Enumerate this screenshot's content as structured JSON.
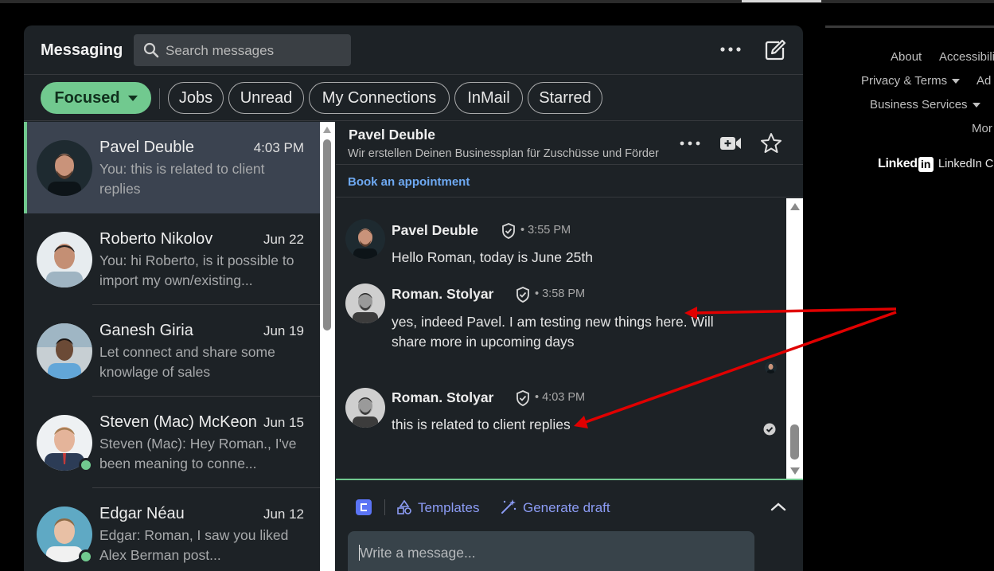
{
  "messaging": {
    "title": "Messaging",
    "search_placeholder": "Search messages",
    "more_icon": "more-horizontal-icon",
    "compose_icon": "compose-icon"
  },
  "filters": [
    {
      "label": "Focused",
      "active": true
    },
    {
      "label": "Jobs"
    },
    {
      "label": "Unread"
    },
    {
      "label": "My Connections"
    },
    {
      "label": "InMail"
    },
    {
      "label": "Starred"
    }
  ],
  "conversations": [
    {
      "name": "Pavel Deuble",
      "date": "4:03 PM",
      "preview": "You: this is related to client replies",
      "active": true,
      "online": false
    },
    {
      "name": "Roberto Nikolov",
      "date": "Jun 22",
      "preview": "You: hi Roberto, is it possible to import my own/existing...",
      "online": false
    },
    {
      "name": "Ganesh Giria",
      "date": "Jun 19",
      "preview": "Let connect and share some knowlage of sales",
      "online": false
    },
    {
      "name": "Steven (Mac) McKeon",
      "date": "Jun 15",
      "preview": "Steven (Mac): Hey Roman., I've been meaning to conne...",
      "online": true
    },
    {
      "name": "Edgar Néau",
      "date": "Jun 12",
      "preview": "Edgar: Roman, I saw you liked Alex Berman post...",
      "online": true
    }
  ],
  "thread": {
    "name": "Pavel Deuble",
    "subtitle": "Wir erstellen Deinen Businessplan für Zuschüsse und Förder",
    "book_link": "Book an appointment",
    "messages": [
      {
        "sender": "Pavel Deuble",
        "time": "• 3:55 PM",
        "text": "Hello Roman, today is June 25th"
      },
      {
        "sender": "Roman. Stolyar",
        "time": "• 3:58 PM",
        "text": "yes, indeed Pavel. I am testing new things here. Will share more in upcoming days"
      },
      {
        "sender": "Roman. Stolyar",
        "time": "• 4:03 PM",
        "text": "this is related to client replies"
      }
    ]
  },
  "composer": {
    "templates_label": "Templates",
    "generate_label": "Generate draft",
    "placeholder": "Write a message..."
  },
  "footer": {
    "about": "About",
    "accessibility": "Accessibili",
    "privacy": "Privacy & Terms",
    "ad": "Ad",
    "business": "Business Services",
    "more": "Mor",
    "logo_word": "Linked",
    "logo_box": "in",
    "corp": "LinkedIn C"
  },
  "colors": {
    "accent_green": "#71c98f",
    "link_blue": "#6ea9f2",
    "annotation_red": "#e00000"
  }
}
